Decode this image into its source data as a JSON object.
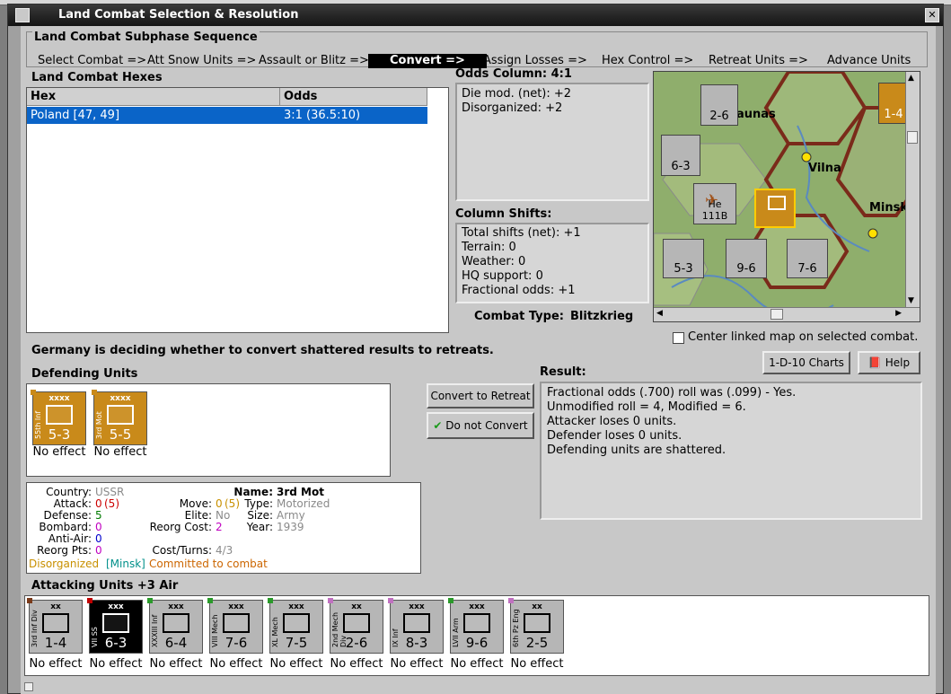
{
  "window": {
    "title": "Land Combat Selection & Resolution",
    "close_label": "✕"
  },
  "sequence": {
    "title": "Land Combat Subphase Sequence",
    "steps": [
      "Select Combat =>",
      "Att Snow Units =>",
      "Assault or Blitz =>",
      "Convert =>",
      "Assign Losses =>",
      "Hex Control =>",
      "Retreat Units =>",
      "Advance Units"
    ],
    "active_index": 3
  },
  "hexes": {
    "title": "Land Combat Hexes",
    "col_hex": "Hex",
    "col_odds": "Odds",
    "rows": [
      {
        "hex": "Poland [47, 49]",
        "odds": "3:1 (36.5:10)"
      }
    ]
  },
  "odds_column": {
    "title": "Odds Column: 4:1",
    "lines": [
      "Die mod. (net): +2",
      "Disorganized: +2"
    ]
  },
  "column_shifts": {
    "title": "Column Shifts:",
    "lines": [
      "Total shifts (net): +1",
      "Terrain: 0",
      "Weather: 0",
      "HQ support: 0",
      "Fractional odds: +1"
    ]
  },
  "combat_type": {
    "label": "Combat Type:",
    "value": "Blitzkrieg"
  },
  "map": {
    "labels": [
      "aunas",
      "Vilna",
      "Minsk"
    ],
    "counters": [
      "2-6",
      "6-3",
      "5-3",
      "9-6",
      "7-6",
      "1-4"
    ],
    "aircraft": "He 111B"
  },
  "center_map_label": "Center linked map on selected combat.",
  "status_message": "Germany is deciding whether to convert shattered results to retreats.",
  "buttons": {
    "charts": "1-D-10 Charts",
    "help": "Help",
    "convert": "Convert to Retreat",
    "not_convert": "Do not Convert"
  },
  "defending": {
    "title": "Defending Units",
    "units": [
      {
        "size": "xxxx",
        "name": "55th Inf",
        "values": "5-3",
        "effect": "No effect",
        "style": "orange"
      },
      {
        "size": "xxxx",
        "name": "3rd Mot",
        "values": "5-5",
        "effect": "No effect",
        "style": "orange"
      }
    ]
  },
  "result": {
    "title": "Result:",
    "lines": [
      "Fractional odds (.700) roll was (.099)  - Yes.",
      "Unmodified roll = 4, Modified = 6.",
      "Attacker loses 0 units.",
      "Defender loses 0 units.",
      "Defending units are shattered."
    ]
  },
  "unit_info": {
    "country_label": "Country:",
    "country": "USSR",
    "attack_label": "Attack:",
    "attack": "0",
    "attack_paren": "(5)",
    "defense_label": "Defense:",
    "defense": "5",
    "bombard_label": "Bombard:",
    "bombard": "0",
    "antiair_label": "Anti-Air:",
    "antiair": "0",
    "reorgpts_label": "Reorg Pts:",
    "reorgpts": "0",
    "move_label": "Move:",
    "move": "0",
    "move_paren": "(5)",
    "elite_label": "Elite:",
    "elite": "No",
    "reorgcost_label": "Reorg Cost:",
    "reorgcost": "2",
    "costturns_label": "Cost/Turns:",
    "costturns": "4/3",
    "name_label": "Name:",
    "name": "3rd Mot",
    "type_label": "Type:",
    "type": "Motorized",
    "size_label": "Size:",
    "size": "Army",
    "year_label": "Year:",
    "year": "1939",
    "status1": "Disorganized",
    "status2": "[Minsk]",
    "status3": "Committed to combat",
    "colors": {
      "red": "#cc0000",
      "green": "#007a00",
      "magenta": "#c000c0",
      "blue": "#0000cc",
      "grey": "#8a8a8a",
      "gold": "#c89000",
      "teal": "#00908a",
      "orange": "#cc6600"
    }
  },
  "attacking": {
    "title": "Attacking Units +3 Air",
    "units": [
      {
        "size": "xx",
        "name": "3rd Inf Div",
        "values": "1-4",
        "effect": "No effect",
        "style": "grey"
      },
      {
        "size": "xxx",
        "name": "VII SS",
        "values": "6-3",
        "effect": "No effect",
        "style": "black"
      },
      {
        "size": "xxx",
        "name": "XXXIII Inf",
        "values": "6-4",
        "effect": "No effect",
        "style": "grey"
      },
      {
        "size": "xxx",
        "name": "VIII Mech",
        "values": "7-6",
        "effect": "No effect",
        "style": "grey"
      },
      {
        "size": "xxx",
        "name": "XL Mech",
        "values": "7-5",
        "effect": "No effect",
        "style": "grey"
      },
      {
        "size": "xx",
        "name": "2nd Mech Div",
        "values": "2-6",
        "effect": "No effect",
        "style": "grey"
      },
      {
        "size": "xxx",
        "name": "IX Inf",
        "values": "8-3",
        "effect": "No effect",
        "style": "grey"
      },
      {
        "size": "xxx",
        "name": "LVII Arm",
        "values": "9-6",
        "effect": "No effect",
        "style": "grey"
      },
      {
        "size": "xx",
        "name": "6th Pz Eng",
        "values": "2-5",
        "effect": "No effect",
        "style": "grey"
      }
    ]
  }
}
